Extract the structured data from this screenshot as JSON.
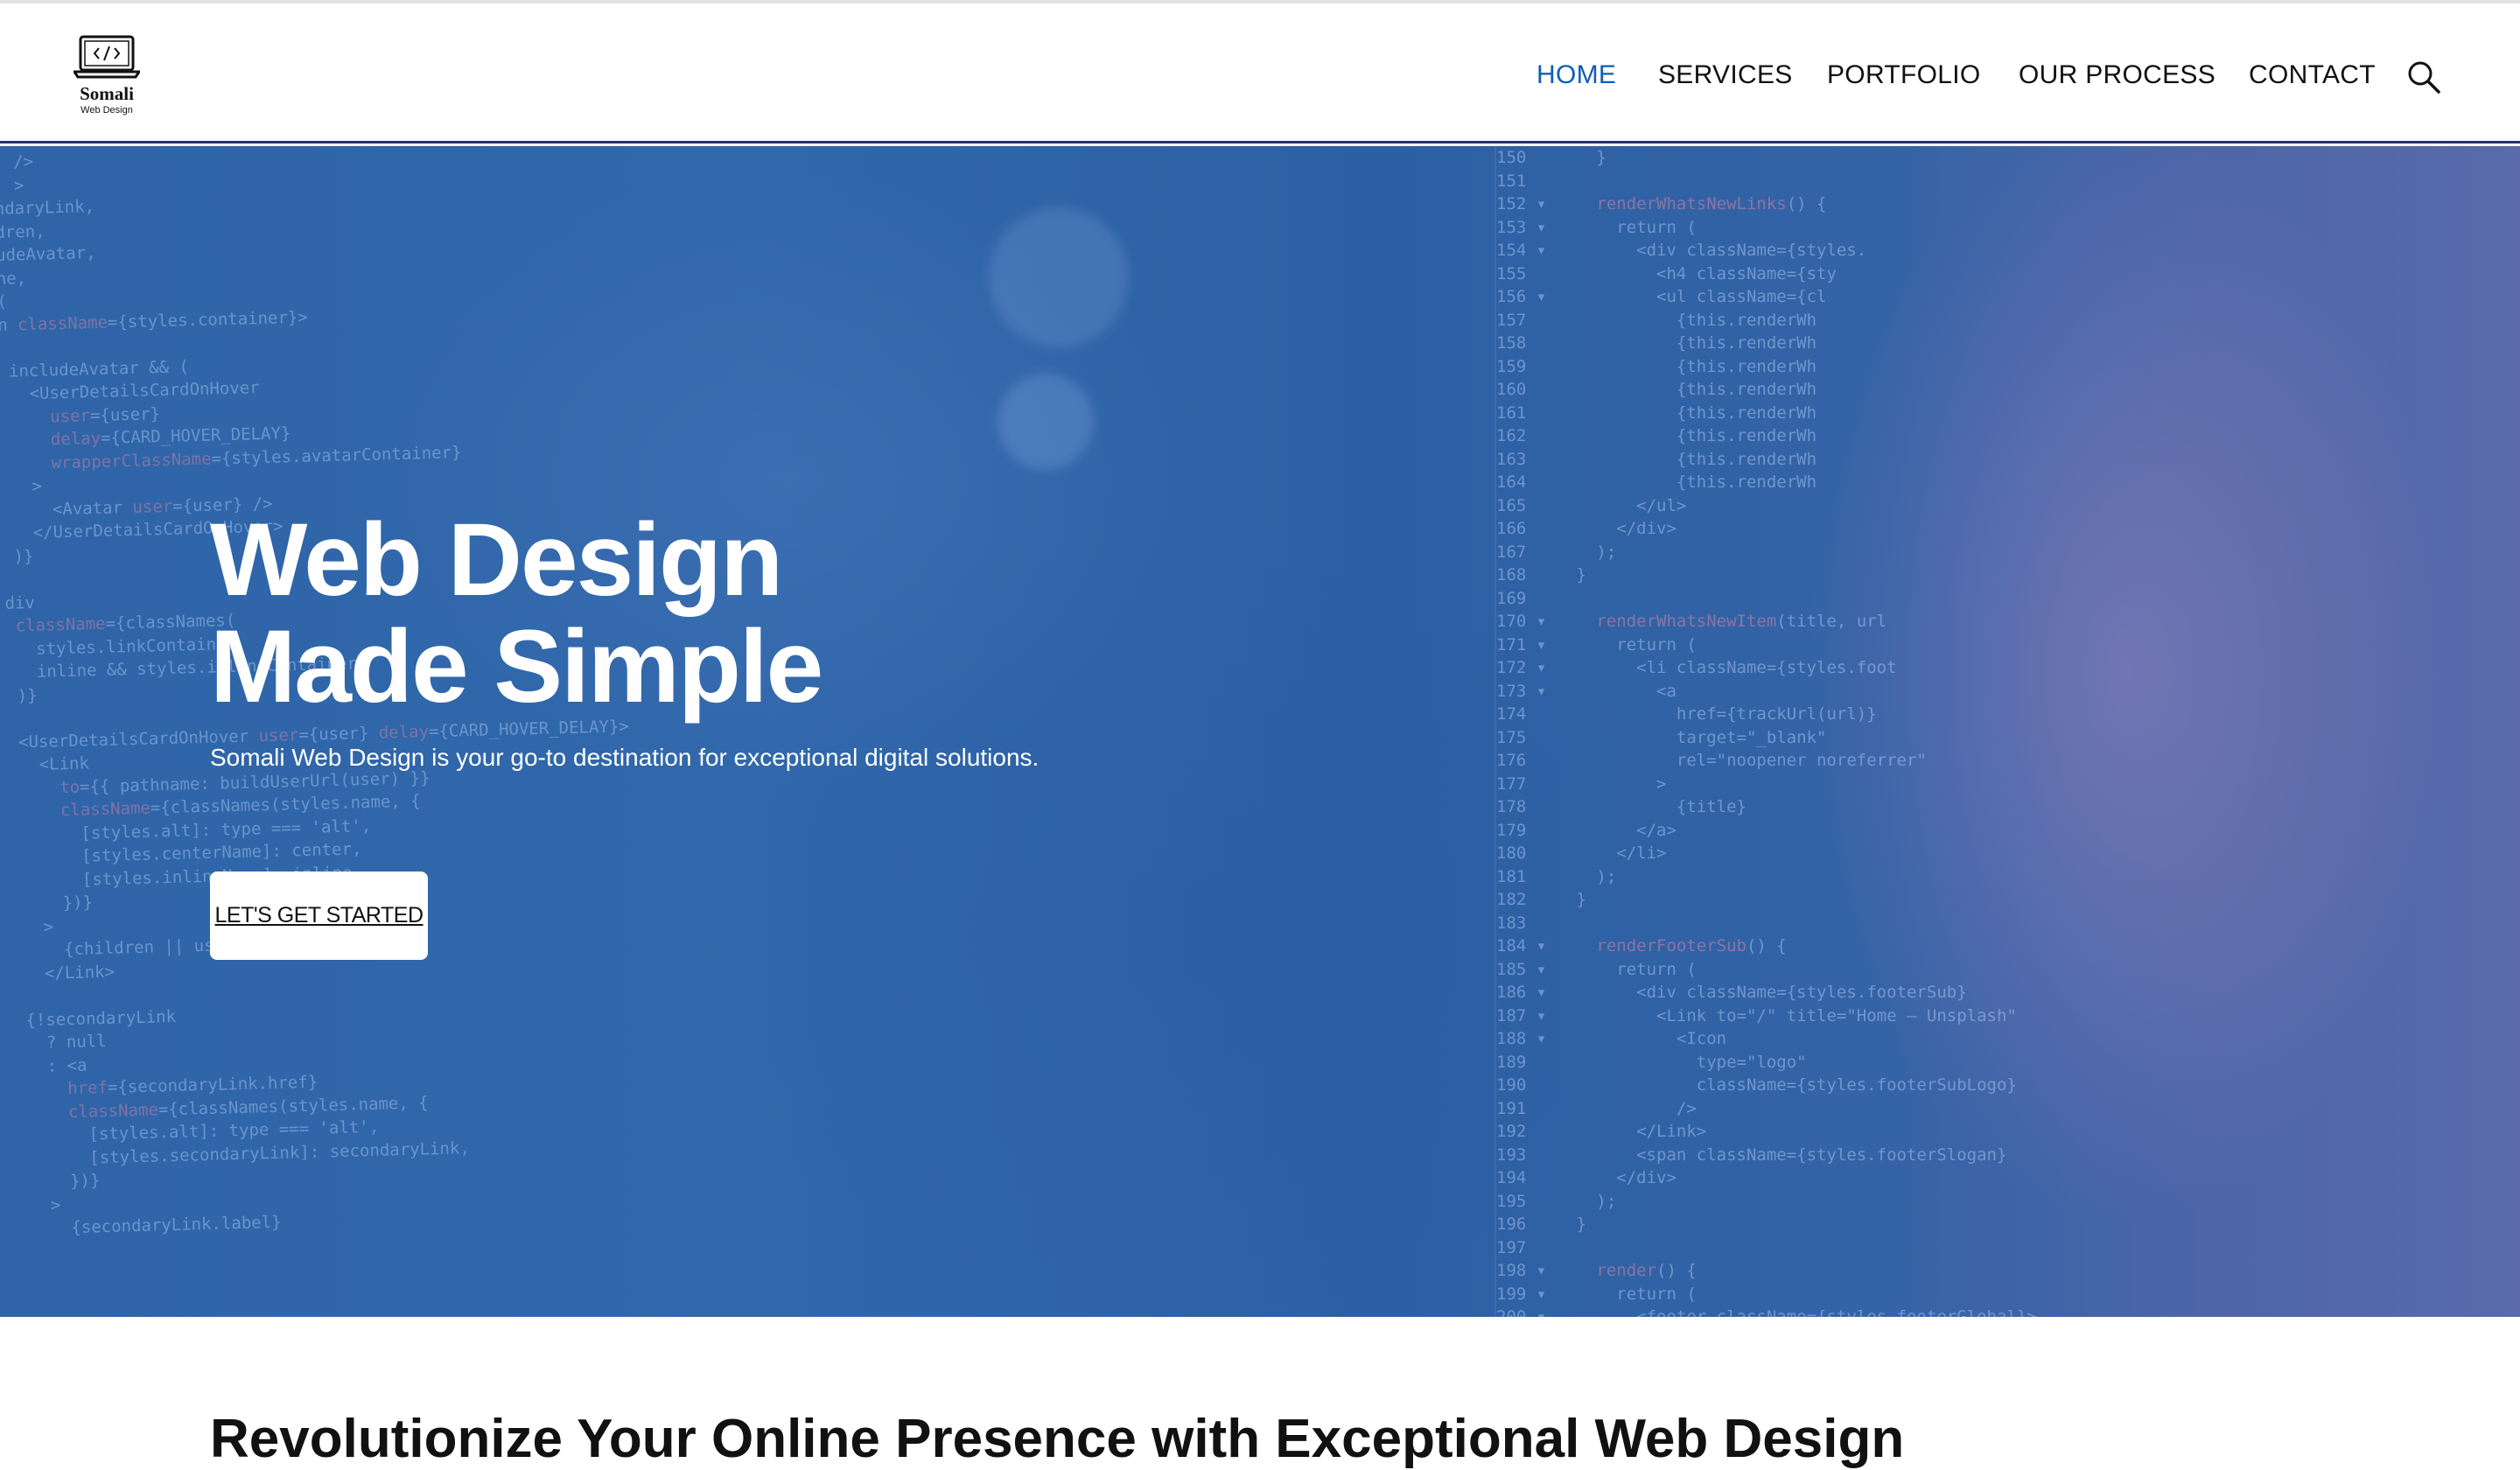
{
  "brand": {
    "name": "Somali",
    "tagline": "Web Design",
    "logo_icon": "laptop-code-icon"
  },
  "nav": {
    "items": [
      {
        "label": "HOME",
        "active": true
      },
      {
        "label": "SERVICES",
        "active": false
      },
      {
        "label": "PORTFOLIO",
        "active": false
      },
      {
        "label": "OUR PROCESS",
        "active": false
      },
      {
        "label": "CONTACT",
        "active": false
      }
    ],
    "search_icon": "search-icon"
  },
  "hero": {
    "title_line1": "Web Design",
    "title_line2": "Made Simple",
    "description": "Somali Web Design is your go-to destination for exceptional digital solutions.",
    "cta_label": "LET'S GET STARTED"
  },
  "section": {
    "heading": "Revolutionize Your Online Presence with Exceptional Web Design"
  },
  "colors": {
    "accent": "#0f5eb8",
    "hero_overlay": "#2f64a8",
    "header_border": "#24336f",
    "text": "#111111"
  }
}
